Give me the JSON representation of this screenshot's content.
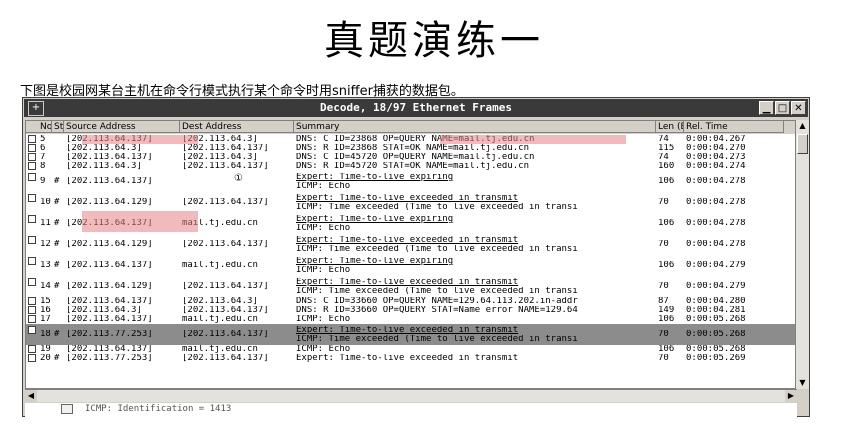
{
  "slide": {
    "title": "真题演练一",
    "caption": "下图是校园网某台主机在命令行模式执行某个命令时用sniffer捕获的数据包。"
  },
  "window": {
    "title": "Decode, 18/97 Ethernet Frames",
    "sys_icon": "+",
    "min_glyph": "▁",
    "max_glyph": "□",
    "close_glyph": "✕"
  },
  "columns": [
    "No.",
    "Stat",
    "Source Address",
    "Dest Address",
    "Summary",
    "Len (B)",
    "Rel. Time"
  ],
  "rows": [
    {
      "no": "5",
      "stat": "",
      "src": "[202.113.64.137]",
      "dst": "[202.113.64.3]",
      "summary": [
        "DNS: C ID=23868 OP=QUERY NAME=mail.tj.edu.cn"
      ],
      "len": "74",
      "time": "0:00:04.267",
      "tall": false
    },
    {
      "no": "6",
      "stat": "",
      "src": "[202.113.64.3]",
      "dst": "[202.113.64.137]",
      "summary": [
        "DNS: R ID=23868 STAT=OK NAME=mail.tj.edu.cn"
      ],
      "len": "115",
      "time": "0:00:04.270",
      "tall": false
    },
    {
      "no": "7",
      "stat": "",
      "src": "[202.113.64.137]",
      "dst": "[202.113.64.3]",
      "summary": [
        "DNS: C ID=45720 OP=QUERY NAME=mail.tj.edu.cn"
      ],
      "len": "74",
      "time": "0:00:04.273",
      "tall": false
    },
    {
      "no": "8",
      "stat": "",
      "src": "[202.113.64.3]",
      "dst": "[202.113.64.137]",
      "summary": [
        "DNS: R ID=45720 STAT=OK NAME=mail.tj.edu.cn"
      ],
      "len": "160",
      "time": "0:00:04.274",
      "tall": false
    },
    {
      "no": "9",
      "stat": "#",
      "src": "[202.113.64.137]",
      "dst": "",
      "summary": [
        "Expert: Time-to-live expiring",
        "ICMP: Echo"
      ],
      "len": "106",
      "time": "0:00:04.278",
      "tall": true
    },
    {
      "no": "10",
      "stat": "#",
      "src": "[202.113.64.129]",
      "dst": "[202.113.64.137]",
      "summary": [
        "Expert: Time-to-live exceeded in transmit",
        "ICMP: Time exceeded (Time to live exceeded in transi"
      ],
      "len": "70",
      "time": "0:00:04.278",
      "tall": true
    },
    {
      "no": "11",
      "stat": "#",
      "src": "[202.113.64.137]",
      "dst": "mail.tj.edu.cn",
      "summary": [
        "Expert: Time-to-live expiring",
        "ICMP: Echo"
      ],
      "len": "106",
      "time": "0:00:04.278",
      "tall": true
    },
    {
      "no": "12",
      "stat": "#",
      "src": "[202.113.64.129]",
      "dst": "[202.113.64.137]",
      "summary": [
        "Expert: Time-to-live exceeded in transmit",
        "ICMP: Time exceeded (Time to live exceeded in transi"
      ],
      "len": "70",
      "time": "0:00:04.278",
      "tall": true
    },
    {
      "no": "13",
      "stat": "#",
      "src": "[202.113.64.137]",
      "dst": "mail.tj.edu.cn",
      "summary": [
        "Expert: Time-to-live expiring",
        "ICMP: Echo"
      ],
      "len": "106",
      "time": "0:00:04.279",
      "tall": true
    },
    {
      "no": "14",
      "stat": "#",
      "src": "[202.113.64.129]",
      "dst": "[202.113.64.137]",
      "summary": [
        "Expert: Time-to-live exceeded in transmit",
        "ICMP: Time exceeded (Time to live exceeded in transi"
      ],
      "len": "70",
      "time": "0:00:04.279",
      "tall": true
    },
    {
      "no": "15",
      "stat": "",
      "src": "[202.113.64.137]",
      "dst": "[202.113.64.3]",
      "summary": [
        "DNS: C ID=33660 OP=QUERY NAME=129.64.113.202.in-addr"
      ],
      "len": "87",
      "time": "0:00:04.280",
      "tall": false
    },
    {
      "no": "16",
      "stat": "",
      "src": "[202.113.64.3]",
      "dst": "[202.113.64.137]",
      "summary": [
        "DNS: R ID=33660 OP=QUERY STAT=Name error NAME=129.64"
      ],
      "len": "149",
      "time": "0:00:04.281",
      "tall": false
    },
    {
      "no": "17",
      "stat": "",
      "src": "[202.113.64.137]",
      "dst": "mail.tj.edu.cn",
      "summary": [
        "ICMP: Echo"
      ],
      "len": "106",
      "time": "0:00:05.268",
      "tall": false
    },
    {
      "no": "18",
      "stat": "#",
      "src": "[202.113.77.253]",
      "dst": "[202.113.64.137]",
      "summary": [
        "Expert: Time-to-live exceeded in transmit",
        "ICMP: Time exceeded (Time to live exceeded in transi"
      ],
      "len": "70",
      "time": "0:00:05.268",
      "tall": true,
      "selected": true
    },
    {
      "no": "19",
      "stat": "",
      "src": "[202.113.64.137]",
      "dst": "mail.tj.edu.cn",
      "summary": [
        "ICMP: Echo"
      ],
      "len": "106",
      "time": "0:00:05.268",
      "tall": false
    },
    {
      "no": "20",
      "stat": "#",
      "src": "[202.113.77.253]",
      "dst": "[202.113.64.137]",
      "summary": [
        "Expert: Time-to-live exceeded in transmit"
      ],
      "len": "70",
      "time": "0:00:05.269",
      "tall": false
    }
  ],
  "annotation_marker": "①",
  "detail_line": "ICMP: Identification = 1413",
  "colors": {
    "highlight": "#e58285",
    "selected_row": "#8c8c8c",
    "titlebar": "#3a3a3a",
    "chrome": "#d4d0c8"
  }
}
